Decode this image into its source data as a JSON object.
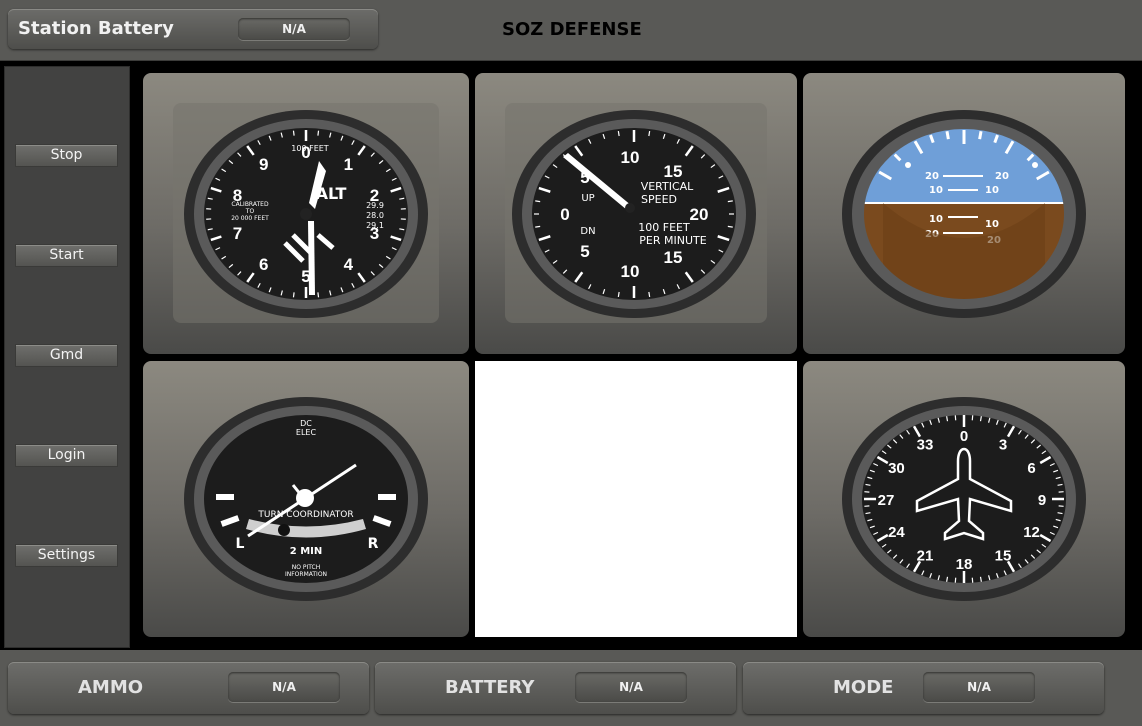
{
  "header": {
    "station_label": "Station Battery",
    "station_value": "N/A",
    "title": "SOZ DEFENSE"
  },
  "sidebar": {
    "buttons": [
      {
        "label": "Stop"
      },
      {
        "label": "Start"
      },
      {
        "label": "Gmd"
      },
      {
        "label": "Login"
      },
      {
        "label": "Settings"
      }
    ]
  },
  "gauges": {
    "altimeter": {
      "numbers": [
        "0",
        "1",
        "2",
        "3",
        "4",
        "5",
        "6",
        "7",
        "8",
        "9"
      ],
      "unit": "100 FEET",
      "label": "ALT",
      "calibration": [
        "CALIBRATED",
        "TO",
        "20 000 FEET"
      ],
      "pressure": [
        "29.9",
        "28.0",
        "29.1"
      ]
    },
    "vsi": {
      "numbers": [
        "0",
        "5",
        "10",
        "15",
        "20",
        "15",
        "10",
        "5"
      ],
      "up": "UP",
      "dn": "DN",
      "title": [
        "VERTICAL",
        "SPEED"
      ],
      "unit": [
        "100 FEET",
        "PER MINUTE"
      ]
    },
    "attitude": {
      "pitch_labels": [
        "20",
        "10",
        "10",
        "20"
      ]
    },
    "turn": {
      "top": [
        "DC",
        "ELEC"
      ],
      "title": "TURN COORDINATOR",
      "left": "L",
      "right": "R",
      "min": "2 MIN",
      "note": [
        "NO PITCH",
        "INFORMATION"
      ]
    },
    "heading": {
      "labels": [
        "0",
        "3",
        "6",
        "9",
        "12",
        "15",
        "18",
        "21",
        "24",
        "27",
        "30",
        "33"
      ]
    }
  },
  "footer": {
    "cards": [
      {
        "label": "AMMO",
        "value": "N/A"
      },
      {
        "label": "BATTERY",
        "value": "N/A"
      },
      {
        "label": "MODE",
        "value": "N/A"
      }
    ]
  },
  "colors": {
    "sky": "#6f9fd8",
    "ground": "#7a4a1e",
    "bezel": "#3f3f3f"
  }
}
